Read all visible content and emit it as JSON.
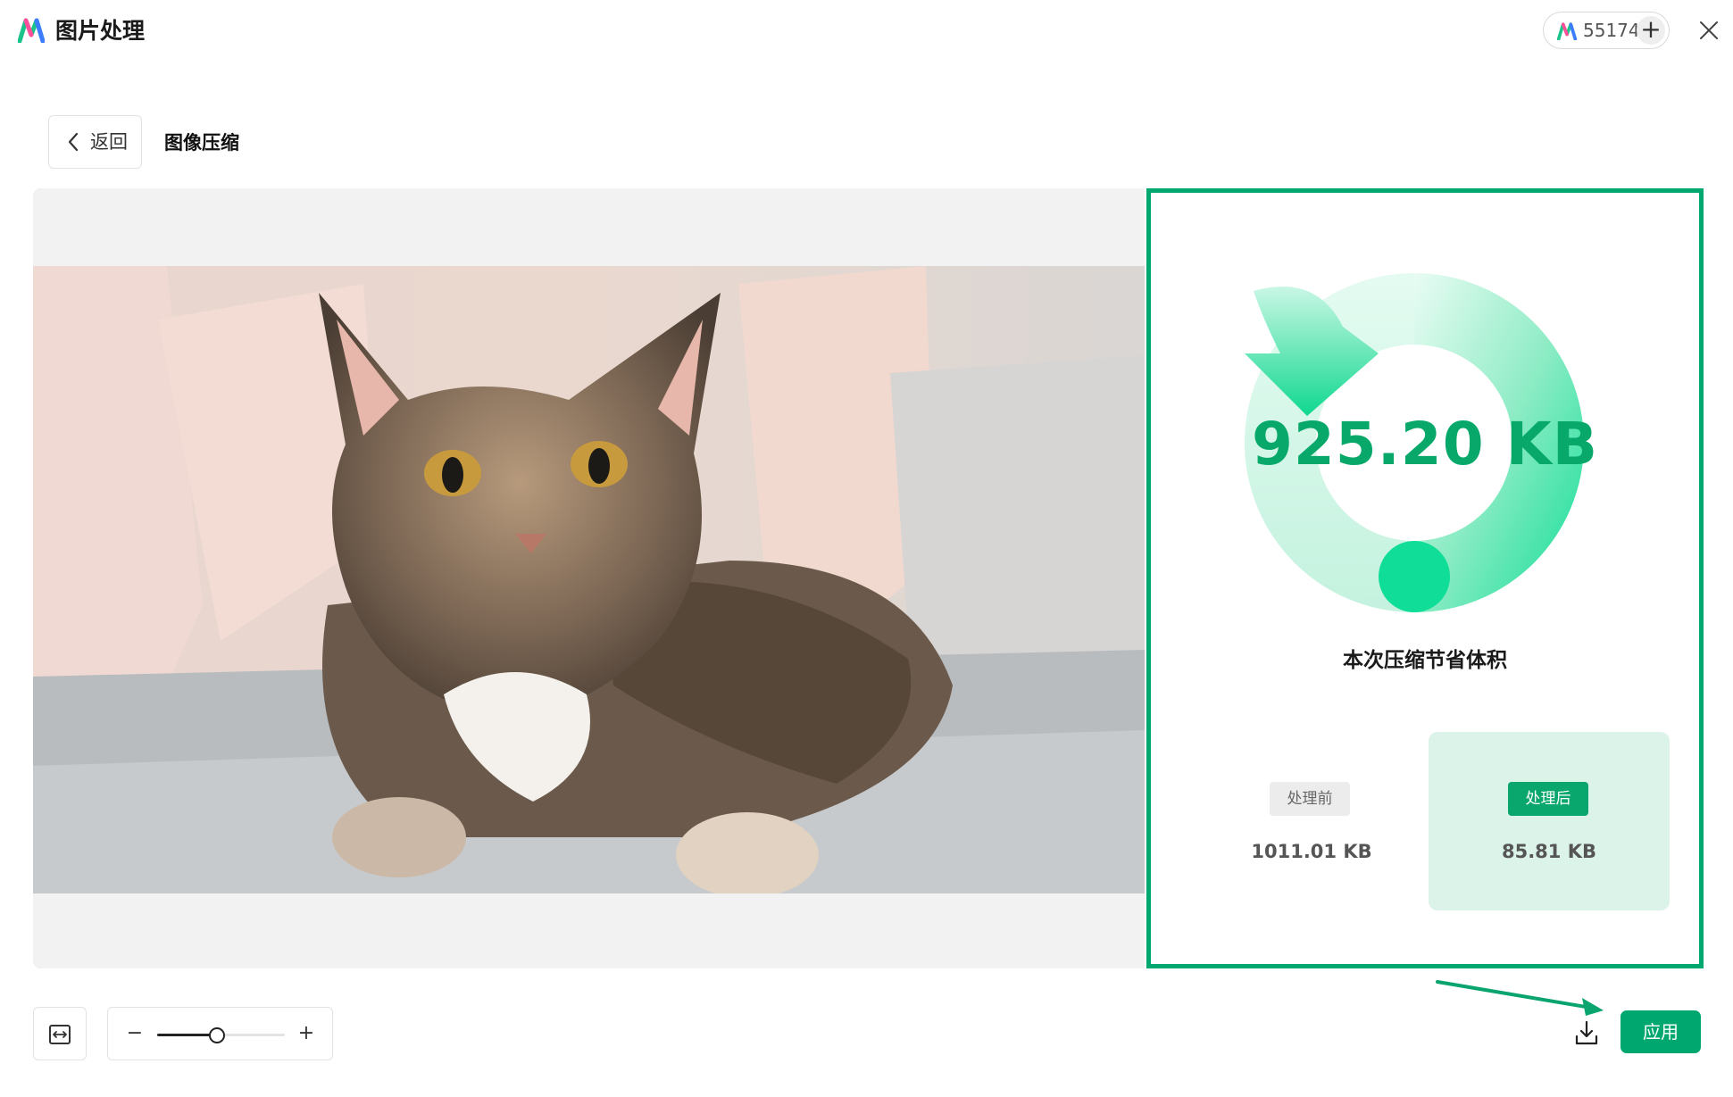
{
  "app": {
    "title": "图片处理",
    "credits": "55174",
    "credits_add_icon": "plus-icon",
    "close_icon": "close-icon"
  },
  "nav": {
    "back_label": "返回",
    "page_title": "图像压缩"
  },
  "result": {
    "saved_size": "925.20 KB",
    "saved_caption": "本次压缩节省体积",
    "before_label": "处理前",
    "before_size": "1011.01 KB",
    "after_label": "处理后",
    "after_size": "85.81 KB"
  },
  "toolbar": {
    "zoom_minus": "−",
    "zoom_plus": "+",
    "zoom_level": 0.47,
    "apply_label": "应用"
  },
  "colors": {
    "accent": "#00a870",
    "accent_light": "#dcf3ea"
  }
}
